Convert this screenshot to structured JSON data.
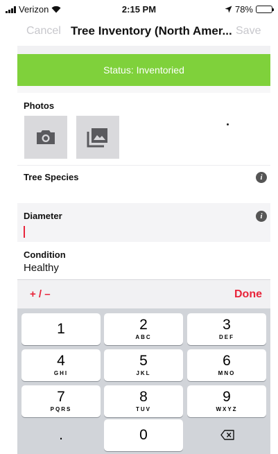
{
  "status_bar": {
    "carrier": "Verizon",
    "time": "2:15 PM",
    "battery": "78%",
    "battery_level": 0.78,
    "icons": [
      "signal-icon",
      "wifi-icon",
      "location-arrow-icon",
      "battery-icon"
    ]
  },
  "nav": {
    "cancel_label": "Cancel",
    "title": "Tree Inventory (North Amer...",
    "save_label": "Save"
  },
  "status_banner": {
    "text": "Status: Inventoried",
    "color": "#7fd13b"
  },
  "form": {
    "photos_label": "Photos",
    "photo_buttons": [
      "camera-icon",
      "gallery-icon"
    ],
    "species_label": "Tree Species",
    "diameter_label": "Diameter",
    "diameter_value": "",
    "condition_label": "Condition",
    "condition_value": "Healthy"
  },
  "accessory": {
    "plus_minus_label": "+ / –",
    "done_label": "Done",
    "accent_color": "#e8243a"
  },
  "keypad": {
    "keys": [
      {
        "num": "1",
        "letters": ""
      },
      {
        "num": "2",
        "letters": "ABC"
      },
      {
        "num": "3",
        "letters": "DEF"
      },
      {
        "num": "4",
        "letters": "GHI"
      },
      {
        "num": "5",
        "letters": "JKL"
      },
      {
        "num": "6",
        "letters": "MNO"
      },
      {
        "num": "7",
        "letters": "PQRS"
      },
      {
        "num": "8",
        "letters": "TUV"
      },
      {
        "num": "9",
        "letters": "WXYZ"
      },
      {
        "num": ".",
        "letters": ""
      },
      {
        "num": "0",
        "letters": ""
      }
    ],
    "backspace_icon": "backspace-icon"
  }
}
